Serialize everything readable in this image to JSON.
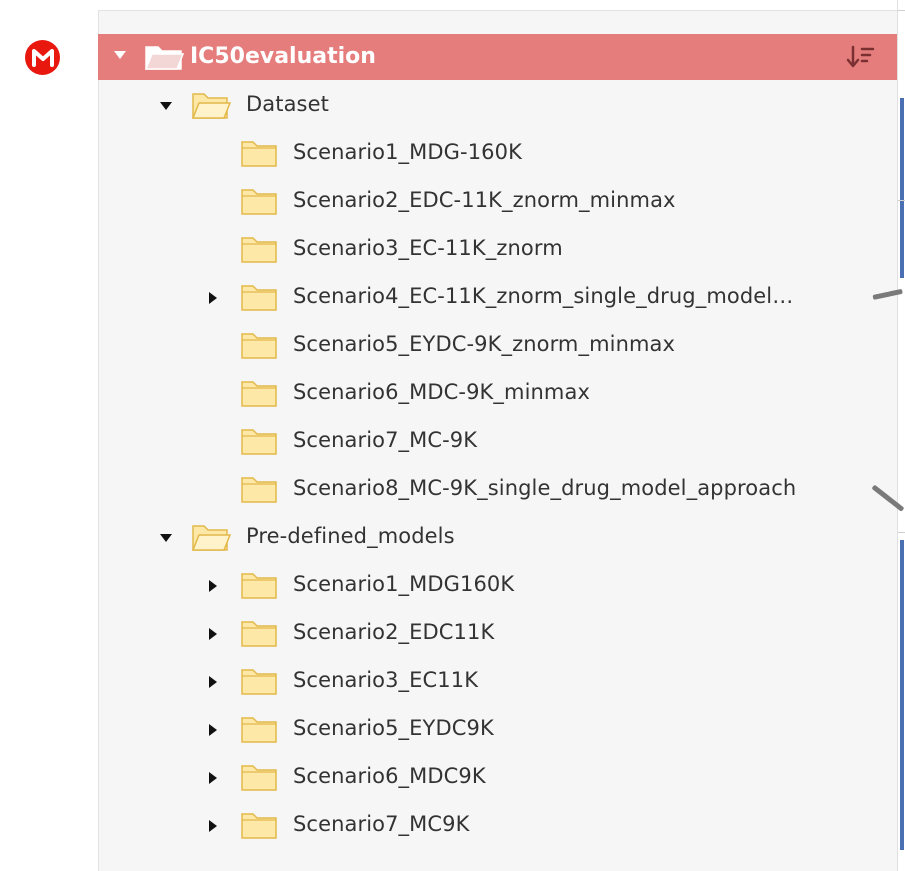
{
  "app": {
    "logo_letter": "M",
    "logo_color": "#e8180f"
  },
  "root": {
    "label": "IC50evaluation",
    "expanded": true,
    "highlight_color": "#e67d7d",
    "sort_icon": "sort-descending-icon"
  },
  "tree": {
    "dataset": {
      "label": "Dataset",
      "expanded": true,
      "children": [
        {
          "label": "Scenario1_MDG-160K",
          "expandable": false
        },
        {
          "label": "Scenario2_EDC-11K_znorm_minmax",
          "expandable": false
        },
        {
          "label": "Scenario3_EC-11K_znorm",
          "expandable": false
        },
        {
          "label": "Scenario4_EC-11K_znorm_single_drug_model…",
          "expandable": true
        },
        {
          "label": "Scenario5_EYDC-9K_znorm_minmax",
          "expandable": false
        },
        {
          "label": "Scenario6_MDC-9K_minmax",
          "expandable": false
        },
        {
          "label": "Scenario7_MC-9K",
          "expandable": false
        },
        {
          "label": "Scenario8_MC-9K_single_drug_model_approach",
          "expandable": false
        }
      ]
    },
    "predefined": {
      "label": "Pre-defined_models",
      "expanded": true,
      "children": [
        {
          "label": "Scenario1_MDG160K",
          "expandable": true
        },
        {
          "label": "Scenario2_EDC11K",
          "expandable": true
        },
        {
          "label": "Scenario3_EC11K",
          "expandable": true
        },
        {
          "label": "Scenario5_EYDC9K",
          "expandable": true
        },
        {
          "label": "Scenario6_MDC9K",
          "expandable": true
        },
        {
          "label": "Scenario7_MC9K",
          "expandable": true
        }
      ]
    }
  },
  "colors": {
    "folder_fill": "#fde8a8",
    "folder_stroke": "#e2b84a",
    "text": "#333333",
    "panel_bg": "#f6f6f6",
    "accent_blue": "#4a6fb3"
  }
}
